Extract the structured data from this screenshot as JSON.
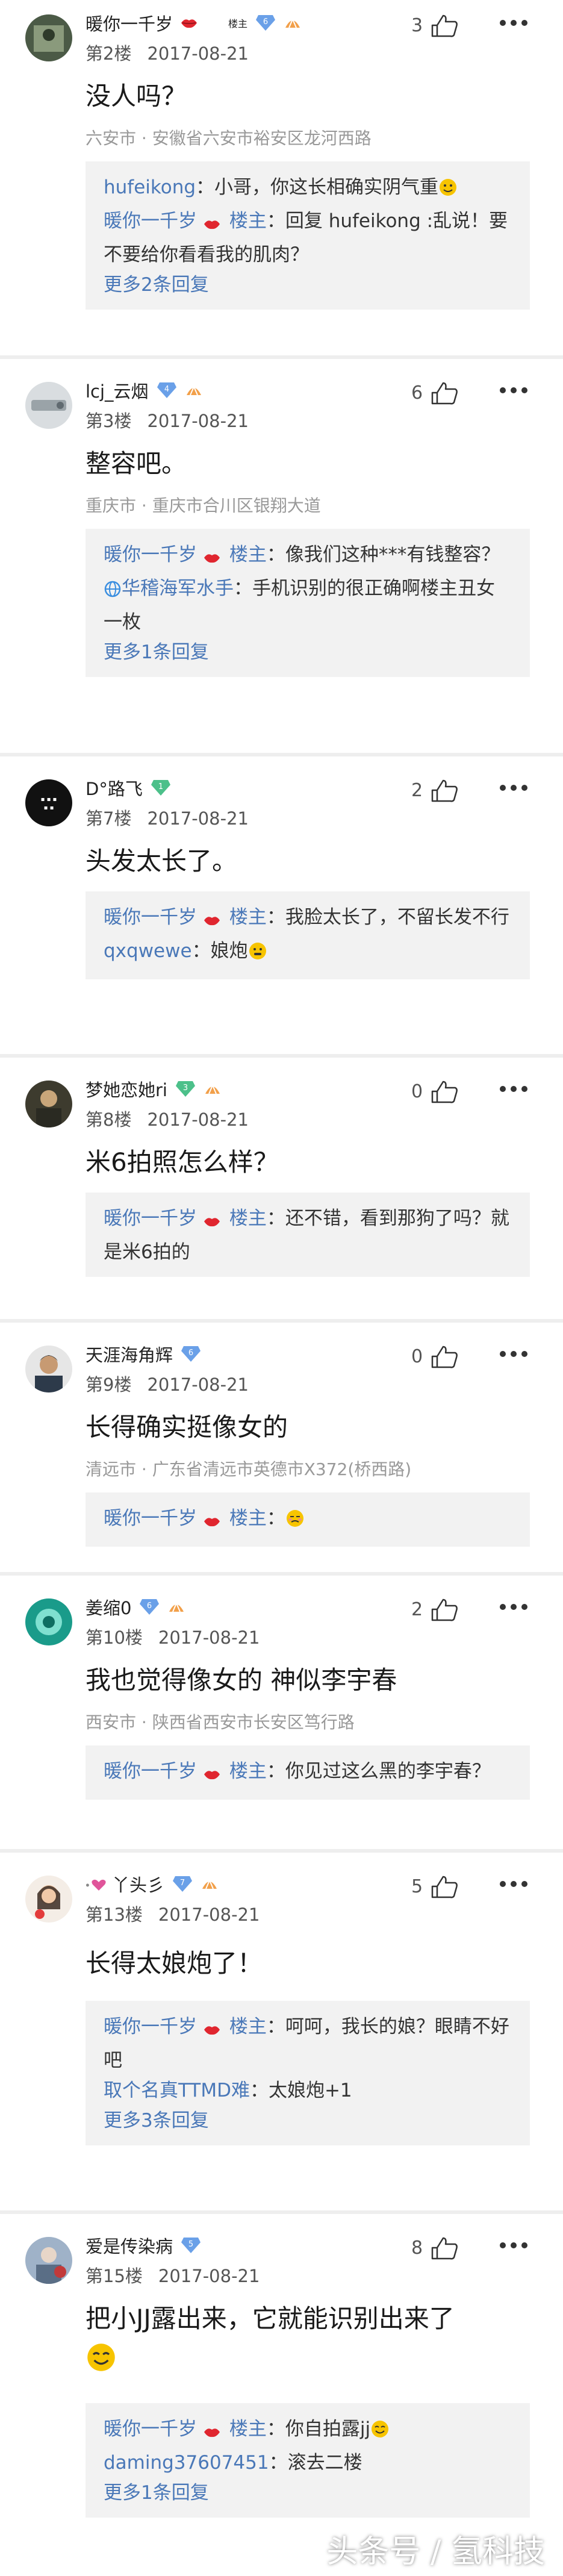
{
  "colors": {
    "link": "#4a78b8",
    "muted": "#999999",
    "reply_bg": "#f2f2f2",
    "text": "#222222"
  },
  "icons": [
    "lips-icon",
    "level-badge-icon",
    "fan-badge-icon",
    "thumb-icon",
    "more-icon",
    "emoji-icon",
    "globe-icon"
  ],
  "posts": [
    {
      "username": "暖你一千岁",
      "level": "6",
      "floor": "第2楼",
      "date": "2017-08-21",
      "likes": "3",
      "owner_label": "楼主",
      "content": "没人吗？",
      "location": "六安市 · 安徽省六安市裕安区龙河西路",
      "replies": [
        {
          "name": "hufeikong",
          "text": "：小哥，你这长相确实阴气重"
        },
        {
          "name": "暖你一千岁",
          "owner": "楼主",
          "text": "：回复 hufeikong :乱说！要不要给你看看我的肌肉？"
        }
      ],
      "more_replies": "更多2条回复"
    },
    {
      "username": "lcj_云烟",
      "level": "4",
      "floor": "第3楼",
      "date": "2017-08-21",
      "likes": "6",
      "content": "整容吧。",
      "location": "重庆市 · 重庆市合川区银翔大道",
      "replies": [
        {
          "name": "暖你一千岁",
          "owner": "楼主",
          "text": "：像我们这种***有钱整容？"
        },
        {
          "name": "华稽海军水手",
          "text": "：手机识别的很正确啊楼主丑女一枚"
        }
      ],
      "more_replies": "更多1条回复"
    },
    {
      "username": "D°路飞",
      "level": "1",
      "floor": "第7楼",
      "date": "2017-08-21",
      "likes": "2",
      "content": "头发太长了。",
      "replies": [
        {
          "name": "暖你一千岁",
          "owner": "楼主",
          "text": "：我脸太长了，不留长发不行"
        },
        {
          "name": "qxqwewe",
          "text": "：娘炮"
        }
      ]
    },
    {
      "username": "梦她恋她ri",
      "level": "3",
      "floor": "第8楼",
      "date": "2017-08-21",
      "likes": "0",
      "content": "米6拍照怎么样？",
      "replies": [
        {
          "name": "暖你一千岁",
          "owner": "楼主",
          "text": "：还不错，看到那狗了吗？就是米6拍的"
        }
      ]
    },
    {
      "username": "天涯海角辉",
      "level": "6",
      "floor": "第9楼",
      "date": "2017-08-21",
      "likes": "0",
      "content": "长得确实挺像女的",
      "location": "清远市 · 广东省清远市英德市X372(桥西路)",
      "replies": [
        {
          "name": "暖你一千岁",
          "owner": "楼主",
          "text": "："
        }
      ]
    },
    {
      "username": "姜缩0",
      "level": "6",
      "floor": "第10楼",
      "date": "2017-08-21",
      "likes": "2",
      "content": "我也觉得像女的 神似李宇春",
      "location": "西安市 · 陕西省西安市长安区笃行路",
      "replies": [
        {
          "name": "暖你一千岁",
          "owner": "楼主",
          "text": "：你见过这么黑的李宇春？"
        }
      ]
    },
    {
      "username": "丫头彡",
      "level": "7",
      "floor": "第13楼",
      "date": "2017-08-21",
      "likes": "5",
      "content": "长得太娘炮了！",
      "replies": [
        {
          "name": "暖你一千岁",
          "owner": "楼主",
          "text": "：呵呵，我长的娘？眼睛不好吧"
        },
        {
          "name": "取个名真TTMD难",
          "text": "：太娘炮+1"
        }
      ],
      "more_replies": "更多3条回复"
    },
    {
      "username": "爱是传染病",
      "level": "5",
      "floor": "第15楼",
      "date": "2017-08-21",
      "likes": "8",
      "content": "把小JJ露出来，它就能识别出来了",
      "replies": [
        {
          "name": "暖你一千岁",
          "owner": "楼主",
          "text": "：你自拍露jj"
        },
        {
          "name": "daming37607451",
          "text": "：滚去二楼"
        }
      ],
      "more_replies": "更多1条回复"
    }
  ],
  "watermark": "头条号 / 氢科技"
}
